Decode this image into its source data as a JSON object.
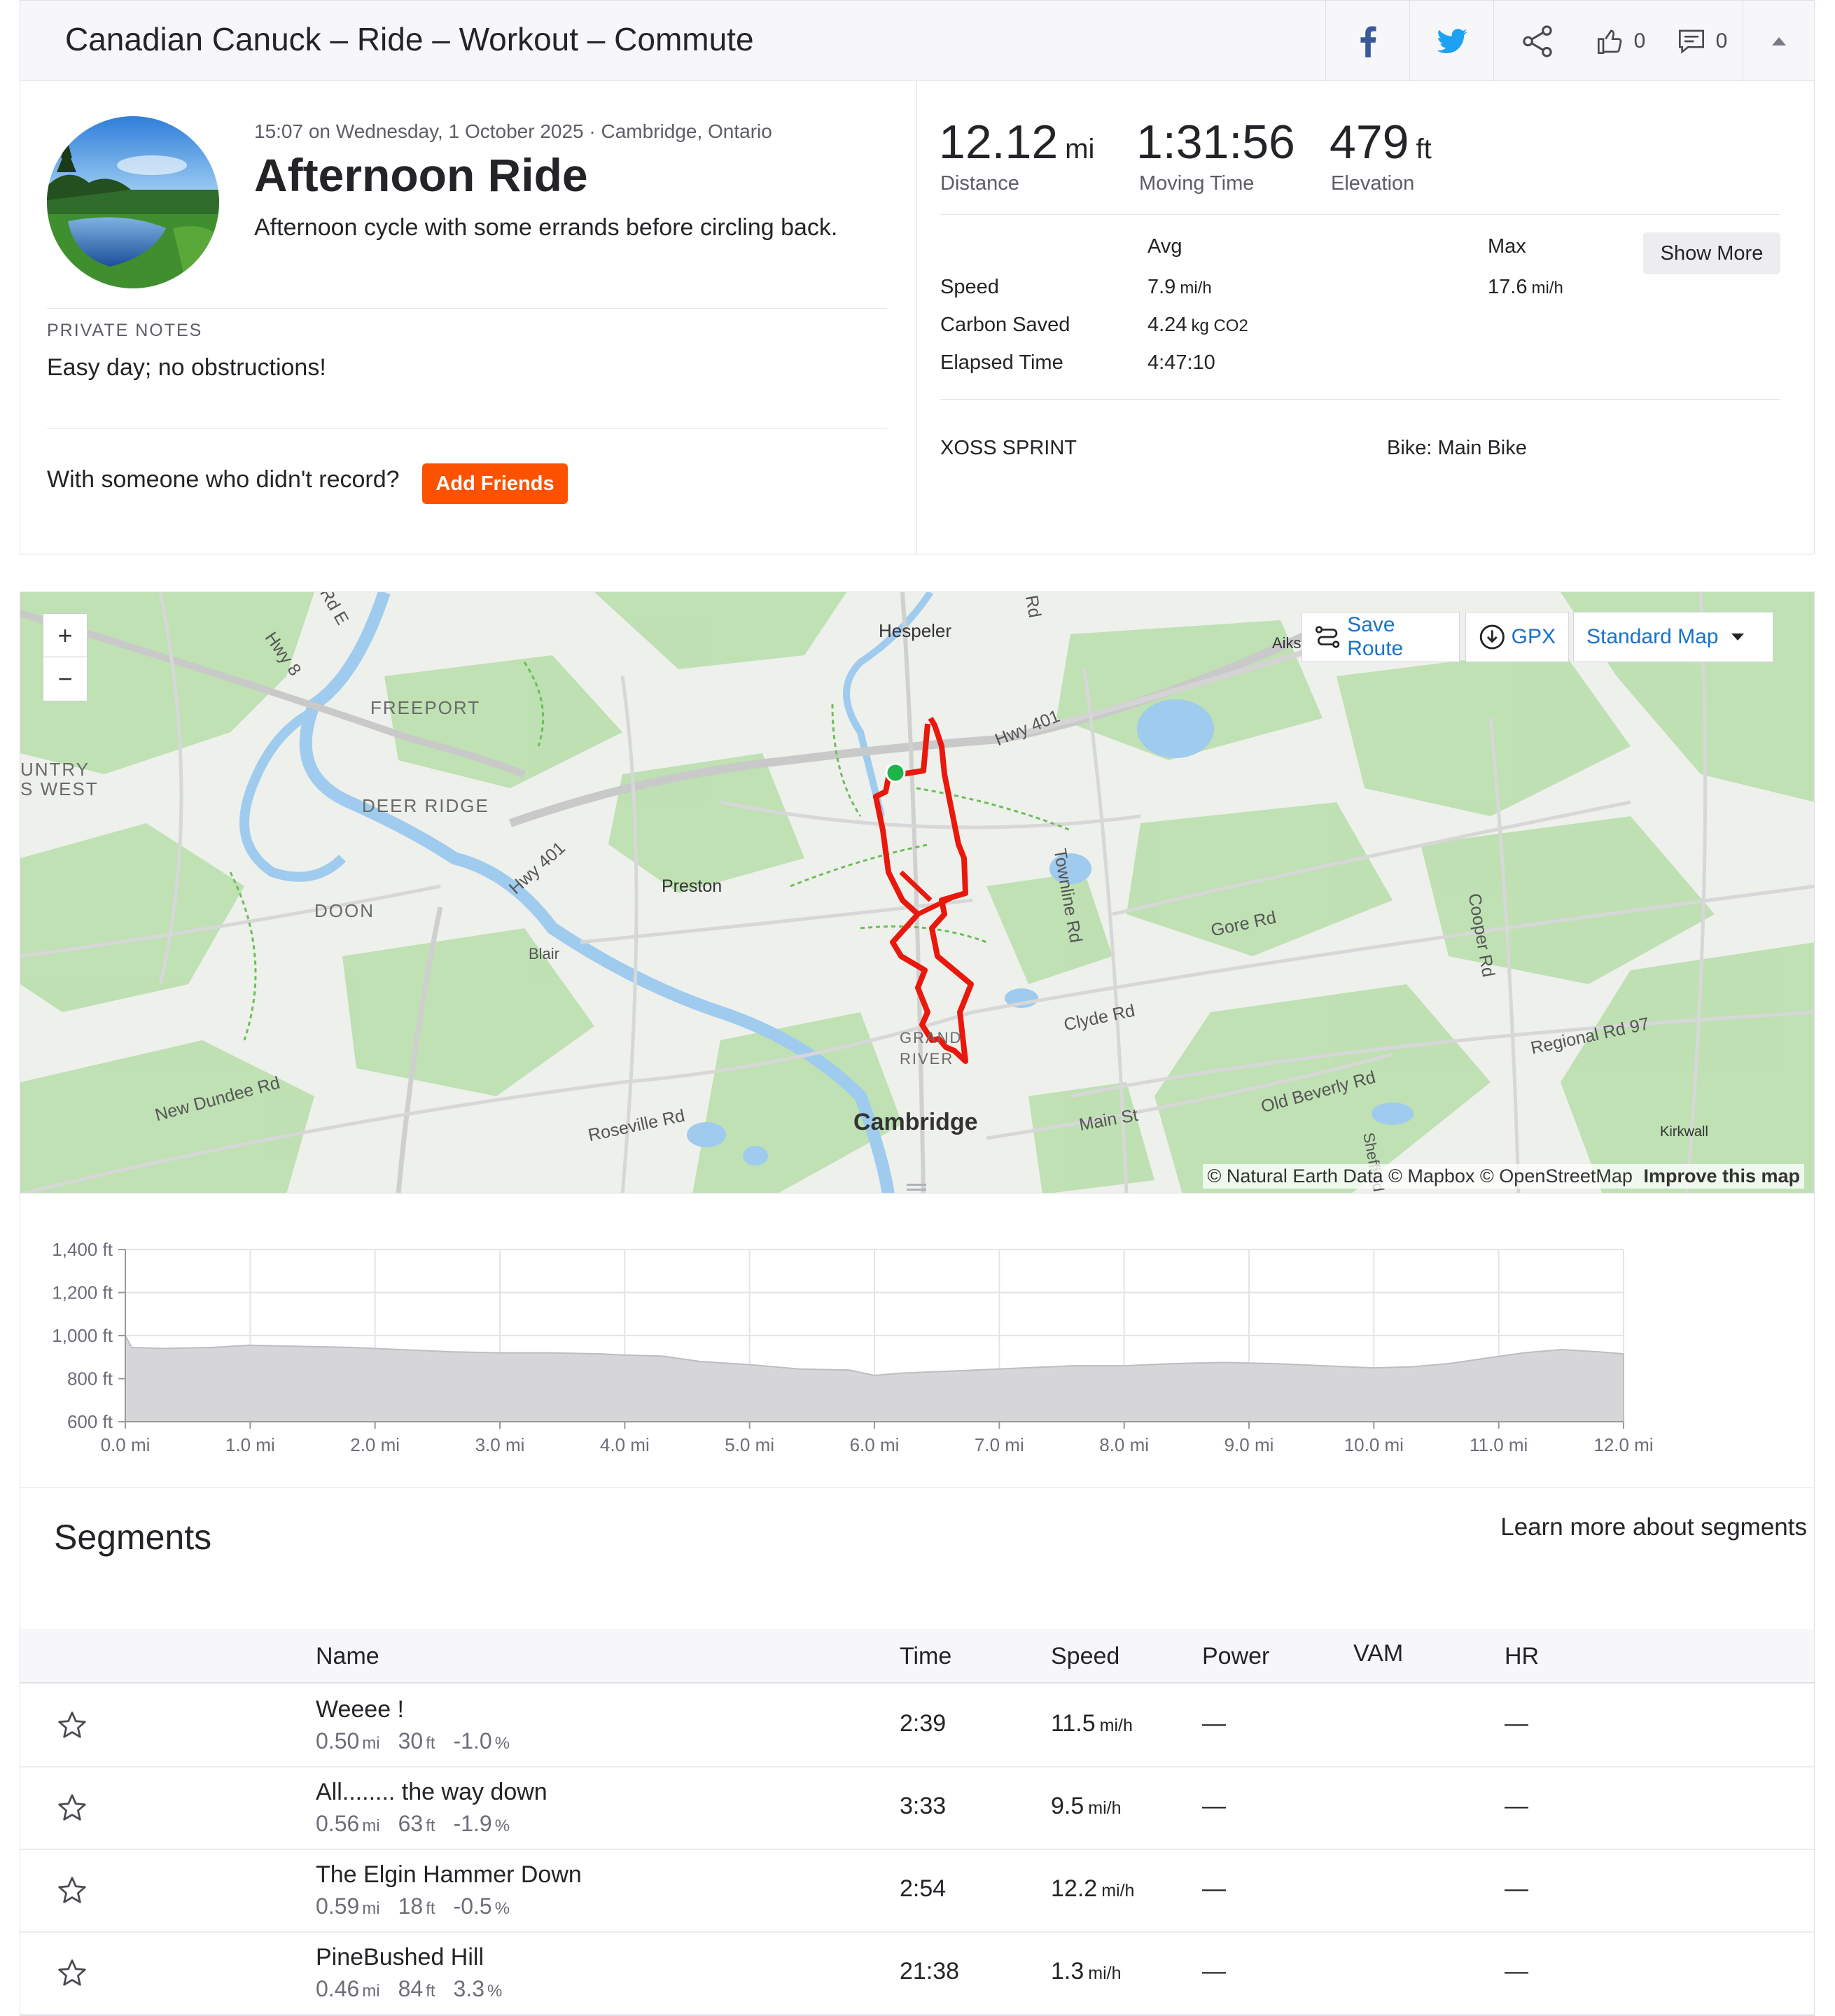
{
  "header": {
    "title": "Canadian Canuck – Ride – Workout – Commute",
    "kudos_count": "0",
    "comments_count": "0"
  },
  "summary": {
    "meta": "15:07 on Wednesday, 1 October 2025 · Cambridge, Ontario",
    "title": "Afternoon Ride",
    "description": "Afternoon cycle with some errands before circling back.",
    "private_notes_label": "PRIVATE NOTES",
    "private_notes": "Easy day; no obstructions!",
    "with_someone": "With someone who didn't record?",
    "add_friends": "Add Friends"
  },
  "stats": {
    "distance": {
      "value": "12.12",
      "unit": "mi",
      "label": "Distance"
    },
    "moving_time": {
      "value": "1:31:56",
      "label": "Moving Time"
    },
    "elevation": {
      "value": "479",
      "unit": "ft",
      "label": "Elevation"
    },
    "avg_header": "Avg",
    "max_header": "Max",
    "show_more": "Show More",
    "rows": [
      {
        "label": "Speed",
        "avg": "7.9",
        "avg_unit": "mi/h",
        "max": "17.6",
        "max_unit": "mi/h"
      },
      {
        "label": "Carbon Saved",
        "avg": "4.24",
        "avg_unit": "kg CO2"
      },
      {
        "label": "Elapsed Time",
        "avg": "4:47:10"
      }
    ],
    "device": "XOSS SPRINT",
    "bike": "Bike: Main Bike"
  },
  "map": {
    "zoom_in": "+",
    "zoom_out": "−",
    "save_route": "Save Route",
    "gpx": "GPX",
    "map_type": "Standard Map",
    "attribution": "© Natural Earth Data © Mapbox © OpenStreetMap",
    "improve": "Improve this map",
    "labels": {
      "hespeler": "Hespeler",
      "freeport": "FREEPORT",
      "deer_ridge": "DEER RIDGE",
      "doon": "DOON",
      "preston": "Preston",
      "blair": "Blair",
      "cambridge": "Cambridge",
      "grand_river_1": "GRAND",
      "grand_river_2": "RIVER",
      "country_west_1": "UNTRY",
      "country_west_2": "S WEST",
      "hwy8": "Hwy 8",
      "hwy401a": "Hwy 401",
      "hwy401b": "Hwy 401",
      "townline": "Townline Rd",
      "gore": "Gore Rd",
      "cooper": "Cooper Rd",
      "clyde": "Clyde Rd",
      "regional97": "Regional Rd 97",
      "old_beverly": "Old Beverly Rd",
      "main_st": "Main St",
      "roseville": "Roseville Rd",
      "new_dundee": "New Dundee Rd",
      "kirkwall": "Kirkwall",
      "aiks": "Aiks",
      "rd_top": "Rd",
      "rde_top": "Rd E",
      "sheffield": "Sheffield"
    },
    "route_color": "#e8190c",
    "start_color": "#1db44a"
  },
  "chart_data": {
    "type": "area",
    "title": "",
    "xlabel": "",
    "ylabel": "",
    "x_unit": "mi",
    "y_unit": "ft",
    "xlim": [
      0,
      12.0
    ],
    "ylim": [
      600,
      1400
    ],
    "x_ticks": [
      "0.0 mi",
      "1.0 mi",
      "2.0 mi",
      "3.0 mi",
      "4.0 mi",
      "5.0 mi",
      "6.0 mi",
      "7.0 mi",
      "8.0 mi",
      "9.0 mi",
      "10.0 mi",
      "11.0 mi",
      "12.0 mi"
    ],
    "y_ticks": [
      "1,400 ft",
      "1,200 ft",
      "1,000 ft",
      "800 ft",
      "600 ft"
    ],
    "y_tick_values": [
      1400,
      1200,
      1000,
      800,
      600
    ],
    "series": [
      {
        "x": [
          0.0,
          0.05,
          0.3,
          0.7,
          1.0,
          1.4,
          1.8,
          2.2,
          2.6,
          3.0,
          3.4,
          3.8,
          4.0,
          4.3,
          4.6,
          5.0,
          5.4,
          5.8,
          6.0,
          6.2,
          6.4,
          6.8,
          7.2,
          7.6,
          8.0,
          8.4,
          8.8,
          9.2,
          9.6,
          10.0,
          10.3,
          10.6,
          10.9,
          11.2,
          11.5,
          11.8,
          12.0
        ],
        "y": [
          1000,
          945,
          940,
          945,
          955,
          950,
          945,
          935,
          925,
          920,
          920,
          915,
          910,
          905,
          880,
          865,
          845,
          840,
          815,
          825,
          830,
          840,
          850,
          860,
          860,
          870,
          875,
          870,
          860,
          850,
          855,
          870,
          895,
          920,
          935,
          925,
          915
        ]
      }
    ]
  },
  "segments": {
    "title": "Segments",
    "learn_more": "Learn more about segments",
    "columns": [
      "Name",
      "Time",
      "Speed",
      "Power",
      "VAM",
      "HR"
    ],
    "rows": [
      {
        "name": "Weeee !",
        "dist": "0.50",
        "dist_unit": "mi",
        "elev": "30",
        "elev_unit": "ft",
        "grade": "-1.0",
        "grade_unit": "%",
        "time": "2:39",
        "speed": "11.5",
        "speed_unit": "mi/h",
        "power": "—",
        "hr": "—"
      },
      {
        "name": "All........ the way down",
        "dist": "0.56",
        "dist_unit": "mi",
        "elev": "63",
        "elev_unit": "ft",
        "grade": "-1.9",
        "grade_unit": "%",
        "time": "3:33",
        "speed": "9.5",
        "speed_unit": "mi/h",
        "power": "—",
        "hr": "—"
      },
      {
        "name": "The Elgin Hammer Down",
        "dist": "0.59",
        "dist_unit": "mi",
        "elev": "18",
        "elev_unit": "ft",
        "grade": "-0.5",
        "grade_unit": "%",
        "time": "2:54",
        "speed": "12.2",
        "speed_unit": "mi/h",
        "power": "—",
        "hr": "—"
      },
      {
        "name": "PineBushed Hill",
        "dist": "0.46",
        "dist_unit": "mi",
        "elev": "84",
        "elev_unit": "ft",
        "grade": "3.3",
        "grade_unit": "%",
        "time": "21:38",
        "speed": "1.3",
        "speed_unit": "mi/h",
        "power": "—",
        "hr": "—"
      }
    ]
  }
}
